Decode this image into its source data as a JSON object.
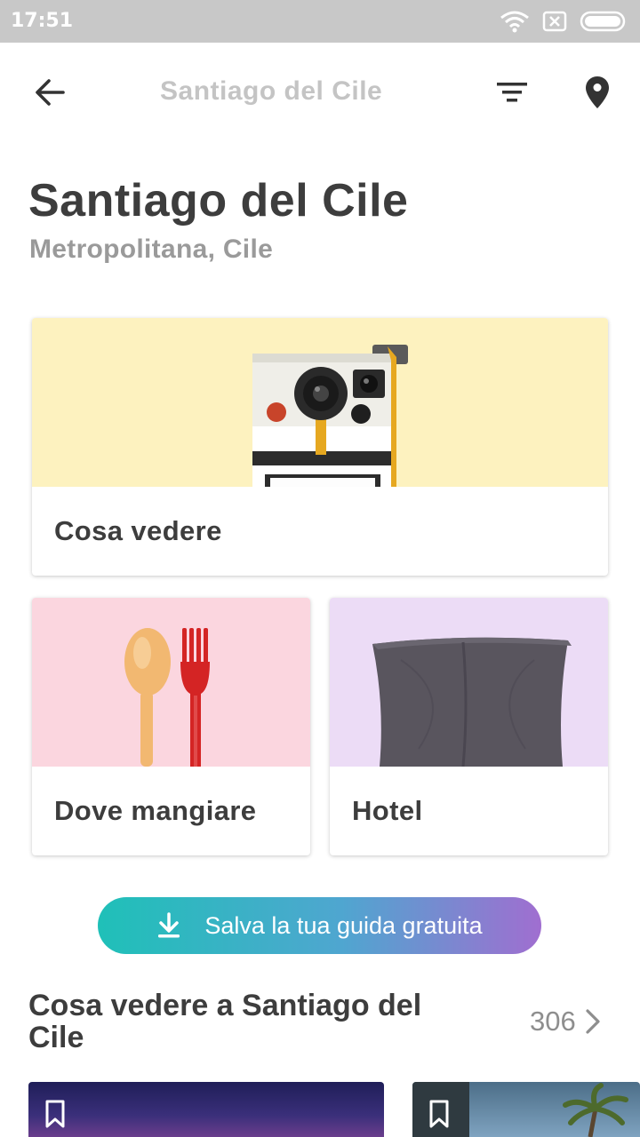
{
  "status_bar": {
    "time": "17:51",
    "icons": [
      "wifi-icon",
      "sim-icon",
      "battery-icon"
    ]
  },
  "toolbar": {
    "title": "Santiago del Cile",
    "back_icon": "arrow-left-icon",
    "filter_icon": "filter-icon",
    "map_icon": "map-pin-icon"
  },
  "header": {
    "title": "Santiago del Cile",
    "subtitle": "Metropolitana, Cile"
  },
  "categories": [
    {
      "label": "Cosa vedere",
      "icon": "camera-icon",
      "color": "#fdf2bf"
    },
    {
      "label": "Dove mangiare",
      "icon": "cutlery-icon",
      "color": "#fbd6df"
    },
    {
      "label": "Hotel",
      "icon": "pillow-icon",
      "color": "#ecdcf6"
    }
  ],
  "save_guide": {
    "label": "Salva la tua guida gratuita",
    "icon": "download-icon"
  },
  "section": {
    "title": "Cosa vedere a Santiago del Cile",
    "count": "306",
    "chevron_icon": "chevron-right-icon"
  },
  "colors": {
    "gradient_start": "#1fc0b8",
    "gradient_end": "#a06ed0",
    "status_bar": "#c8c8c8"
  }
}
